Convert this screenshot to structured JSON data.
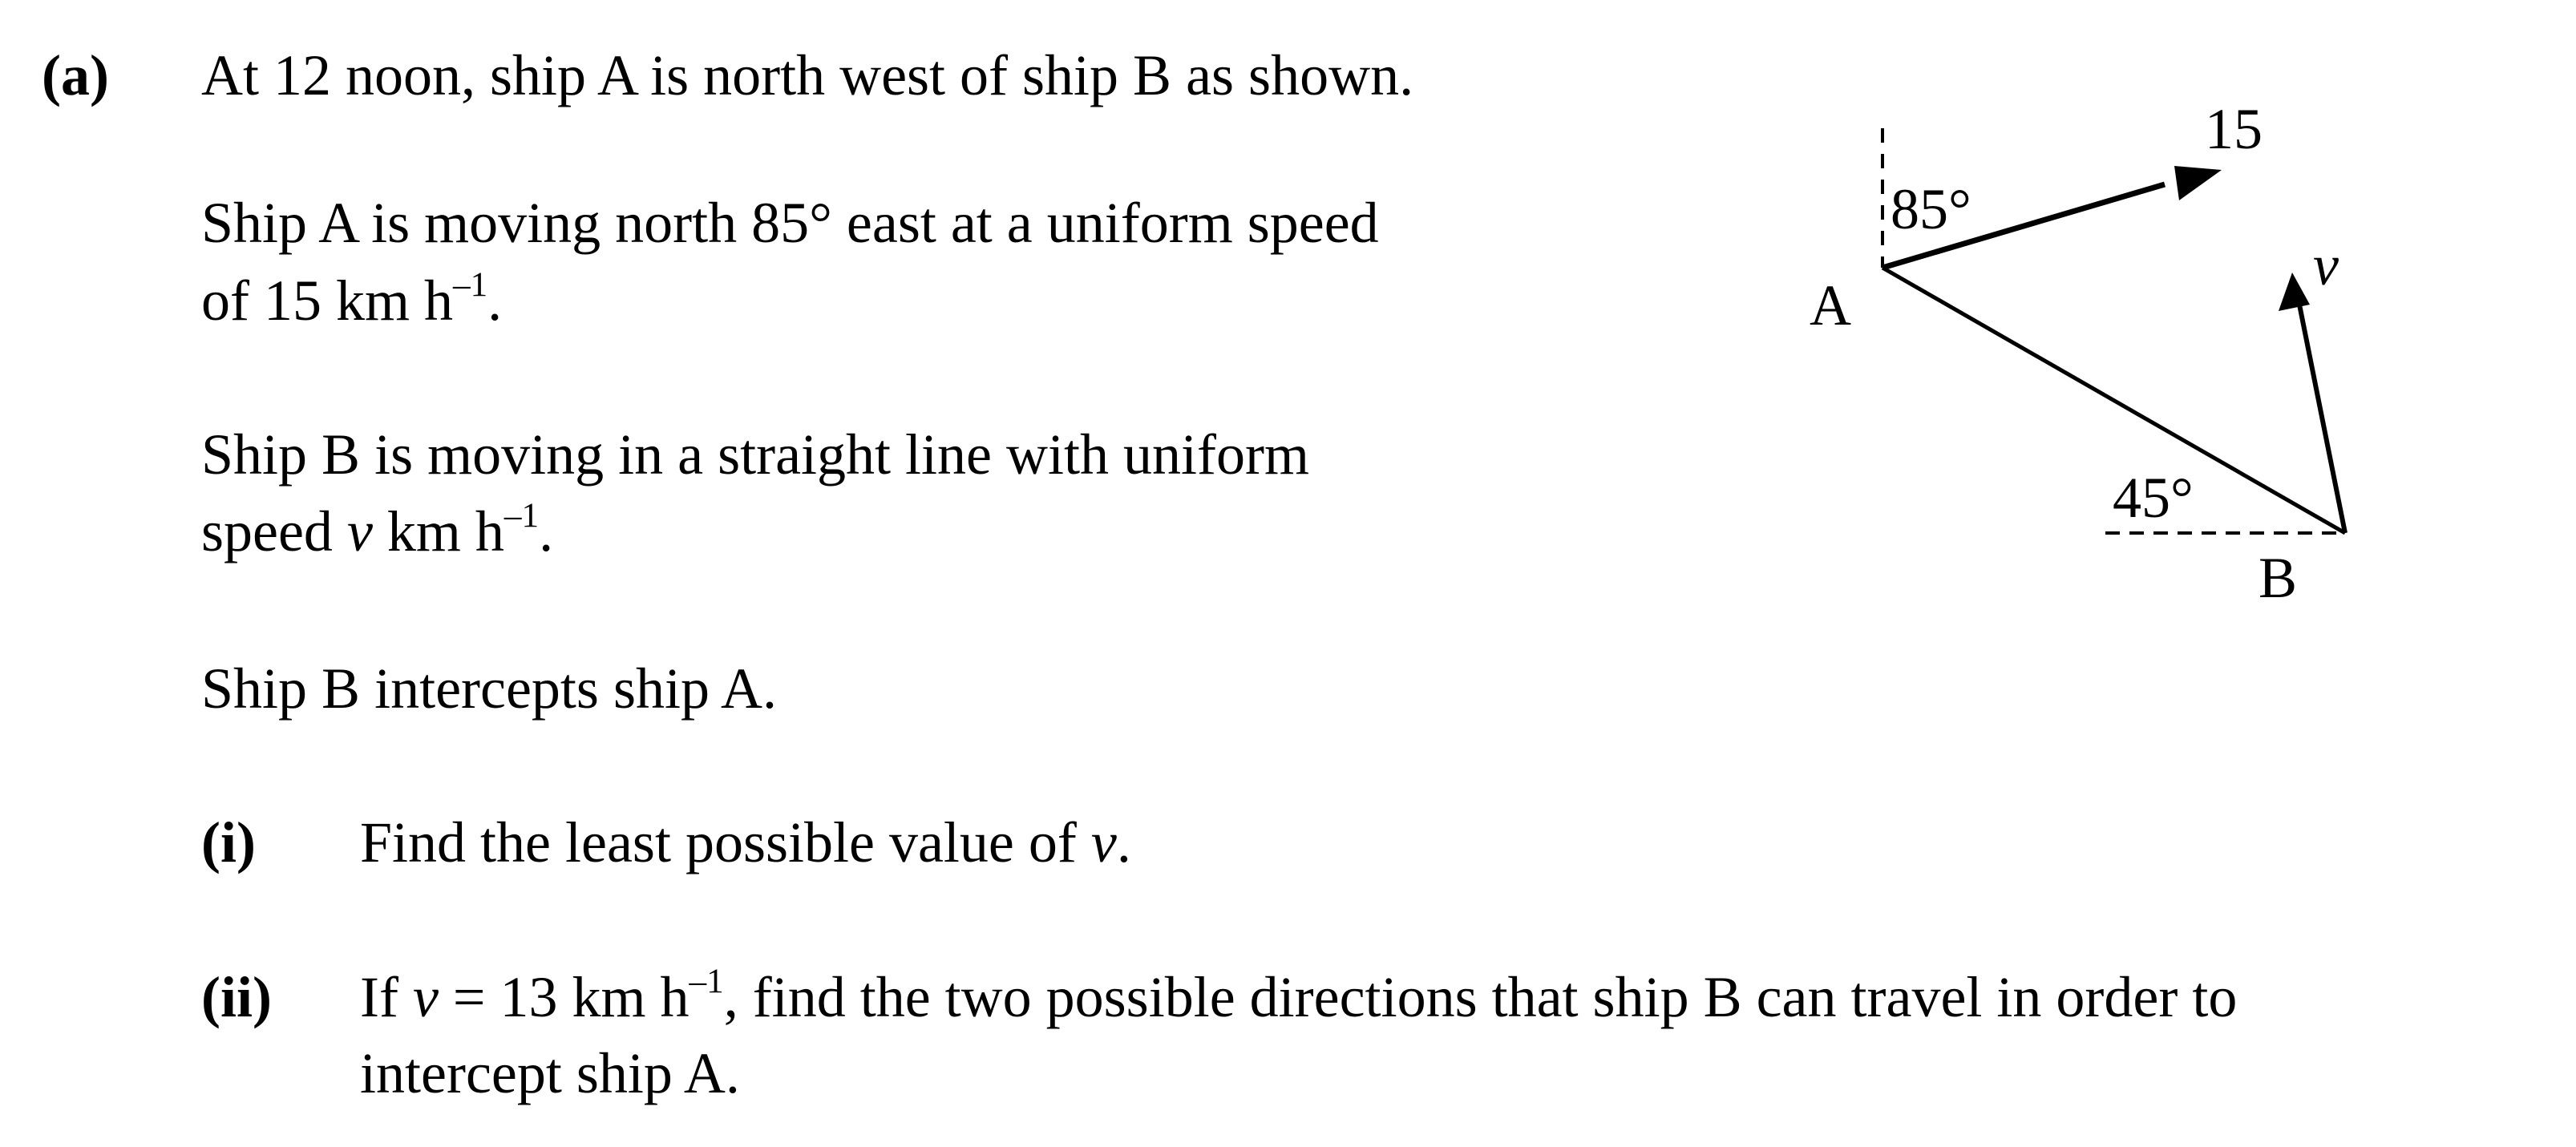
{
  "part_label": "(a)",
  "intro": "At 12 noon, ship A is north west of ship B as shown.",
  "para1": {
    "line1": "Ship A is moving north 85° east at a uniform speed",
    "line2_pre": "of 15 km h",
    "sup": "–1",
    "line2_post": "."
  },
  "para2": {
    "line1": "Ship B is moving in a straight line with uniform",
    "line2_pre": "speed ",
    "var": "v",
    "line2_mid": " km h",
    "sup": "–1",
    "line2_post": "."
  },
  "para3": "Ship B intercepts ship A.",
  "q1": {
    "label": "(i)",
    "text_pre": "Find the least possible value of ",
    "var": "v",
    "text_post": "."
  },
  "q2": {
    "label": "(ii)",
    "pre": "If ",
    "var": "v",
    "mid": " = 13 km h",
    "sup": "–1",
    "post": ", find the two possible directions that ship B can travel in order to",
    "line2": "intercept ship A."
  },
  "diagram": {
    "label_a": "A",
    "label_b": "B",
    "angle_a": "85°",
    "angle_b": "45°",
    "speed_a": "15",
    "speed_b": "v"
  }
}
